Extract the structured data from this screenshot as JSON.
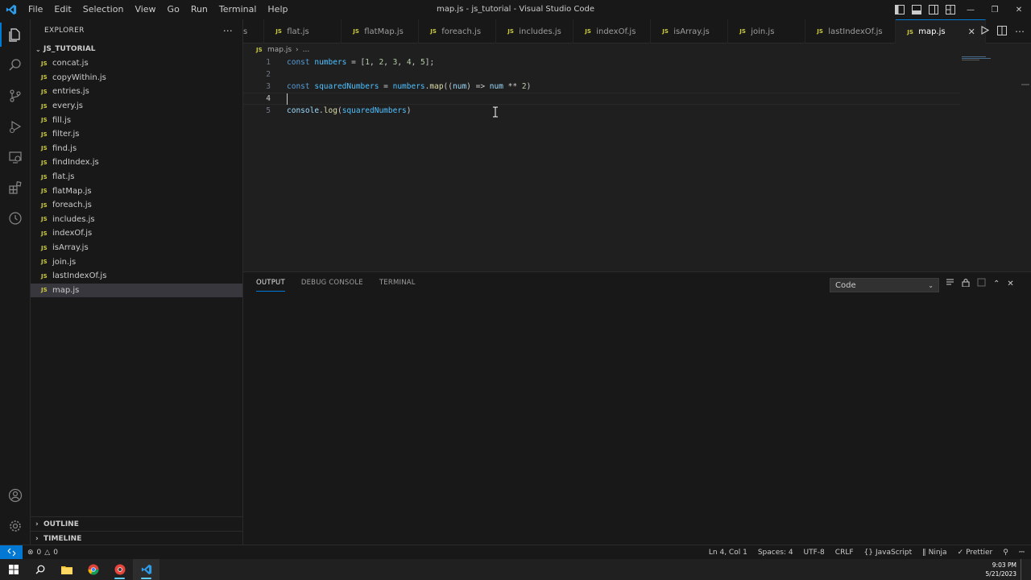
{
  "window": {
    "title": "map.js - js_tutorial - Visual Studio Code"
  },
  "menu": [
    "File",
    "Edit",
    "Selection",
    "View",
    "Go",
    "Run",
    "Terminal",
    "Help"
  ],
  "sidebar": {
    "title": "EXPLORER",
    "folder": "JS_TUTORIAL",
    "files": [
      "concat.js",
      "copyWithin.js",
      "entries.js",
      "every.js",
      "fill.js",
      "filter.js",
      "find.js",
      "findIndex.js",
      "flat.js",
      "flatMap.js",
      "foreach.js",
      "includes.js",
      "indexOf.js",
      "isArray.js",
      "join.js",
      "lastIndexOf.js",
      "map.js"
    ],
    "selected_file": "map.js",
    "outline": "OUTLINE",
    "timeline": "TIMELINE"
  },
  "tabs": {
    "partial": "s",
    "items": [
      "flat.js",
      "flatMap.js",
      "foreach.js",
      "includes.js",
      "indexOf.js",
      "isArray.js",
      "join.js",
      "lastIndexOf.js",
      "map.js"
    ],
    "active": "map.js"
  },
  "breadcrumb": {
    "file": "map.js",
    "rest": "..."
  },
  "editor": {
    "line_numbers": [
      "1",
      "2",
      "3",
      "4",
      "5"
    ],
    "line1": {
      "kw": "const",
      "var": "numbers",
      "rest1": " = [",
      "n1": "1",
      "c1": ", ",
      "n2": "2",
      "c2": ", ",
      "n3": "3",
      "c3": ", ",
      "n4": "4",
      "c4": ", ",
      "n5": "5",
      "end": "];"
    },
    "line3": {
      "kw": "const",
      "var": "squaredNumbers",
      "eq": " = ",
      "obj": "numbers",
      "dot": ".",
      "fn": "map",
      "open": "((",
      "param": "num",
      "arrow": ") => ",
      "param2": "num",
      "op": " ** ",
      "num": "2",
      "close": ")"
    },
    "line5": {
      "obj": "console",
      "dot": ".",
      "fn": "log",
      "open": "(",
      "arg": "squaredNumbers",
      "close": ")"
    },
    "current_line": 4
  },
  "panel": {
    "tabs": [
      "OUTPUT",
      "DEBUG CONSOLE",
      "TERMINAL"
    ],
    "active_tab": "OUTPUT",
    "channel": "Code"
  },
  "statusbar": {
    "errors": "0",
    "warnings": "0",
    "position": "Ln 4, Col 1",
    "spaces": "Spaces: 4",
    "encoding": "UTF-8",
    "eol": "CRLF",
    "language": "JavaScript",
    "ninja": "Ninja",
    "prettier": "Prettier"
  },
  "taskbar": {
    "time": "9:03 PM",
    "date": "5/21/2023"
  },
  "colors": {
    "accent": "#0078d4",
    "js_badge": "#cbcb41"
  }
}
